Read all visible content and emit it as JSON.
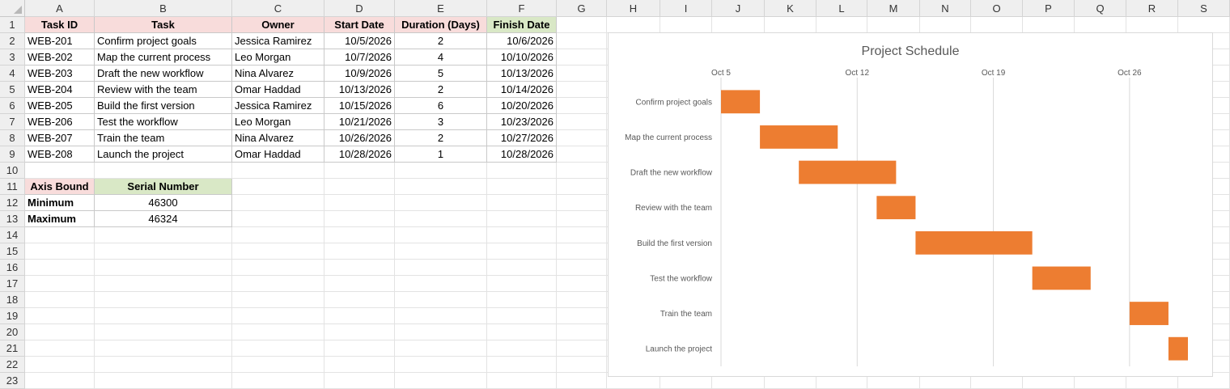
{
  "columns": [
    "A",
    "B",
    "C",
    "D",
    "E",
    "F",
    "G",
    "H",
    "I",
    "J",
    "K",
    "L",
    "M",
    "N",
    "O",
    "P",
    "Q",
    "R",
    "S"
  ],
  "rows": [
    "1",
    "2",
    "3",
    "4",
    "5",
    "6",
    "7",
    "8",
    "9",
    "10",
    "11",
    "12",
    "13",
    "14",
    "15",
    "16",
    "17",
    "18",
    "19",
    "20",
    "21",
    "22",
    "23"
  ],
  "table": {
    "headers": [
      "Task ID",
      "Task",
      "Owner",
      "Start Date",
      "Duration (Days)",
      "Finish Date"
    ],
    "rows": [
      [
        "WEB-201",
        "Confirm project goals",
        "Jessica Ramirez",
        "10/5/2026",
        "2",
        "10/6/2026"
      ],
      [
        "WEB-202",
        "Map the current process",
        "Leo Morgan",
        "10/7/2026",
        "4",
        "10/10/2026"
      ],
      [
        "WEB-203",
        "Draft the new workflow",
        "Nina Alvarez",
        "10/9/2026",
        "5",
        "10/13/2026"
      ],
      [
        "WEB-204",
        "Review with the team",
        "Omar Haddad",
        "10/13/2026",
        "2",
        "10/14/2026"
      ],
      [
        "WEB-205",
        "Build the first version",
        "Jessica Ramirez",
        "10/15/2026",
        "6",
        "10/20/2026"
      ],
      [
        "WEB-206",
        "Test the workflow",
        "Leo Morgan",
        "10/21/2026",
        "3",
        "10/23/2026"
      ],
      [
        "WEB-207",
        "Train the team",
        "Nina Alvarez",
        "10/26/2026",
        "2",
        "10/27/2026"
      ],
      [
        "WEB-208",
        "Launch the project",
        "Omar Haddad",
        "10/28/2026",
        "1",
        "10/28/2026"
      ]
    ]
  },
  "axis_table": {
    "headers": [
      "Axis Bound",
      "Serial Number"
    ],
    "rows": [
      [
        "Minimum",
        "46300"
      ],
      [
        "Maximum",
        "46324"
      ]
    ]
  },
  "colors": {
    "header_pink": "#f8dcdb",
    "header_green": "#d9e8c6",
    "bar": "#ed7d31",
    "gridline": "#d9d9d9"
  },
  "chart_data": {
    "type": "bar",
    "orientation": "horizontal-gantt",
    "title": "Project Schedule",
    "categories": [
      "Confirm project goals",
      "Map the current process",
      "Draft the new workflow",
      "Review with the team",
      "Build the first version",
      "Test the workflow",
      "Train the team",
      "Launch the project"
    ],
    "start": [
      46300,
      46302,
      46304,
      46308,
      46310,
      46316,
      46321,
      46323
    ],
    "duration": [
      2,
      4,
      5,
      2,
      6,
      3,
      2,
      1
    ],
    "xlim": [
      46300,
      46324
    ],
    "xticks": [
      46300,
      46307,
      46314,
      46321
    ],
    "xtick_labels": [
      "Oct 5",
      "Oct 12",
      "Oct 19",
      "Oct 26"
    ],
    "gridlines": true,
    "legend": "none"
  }
}
